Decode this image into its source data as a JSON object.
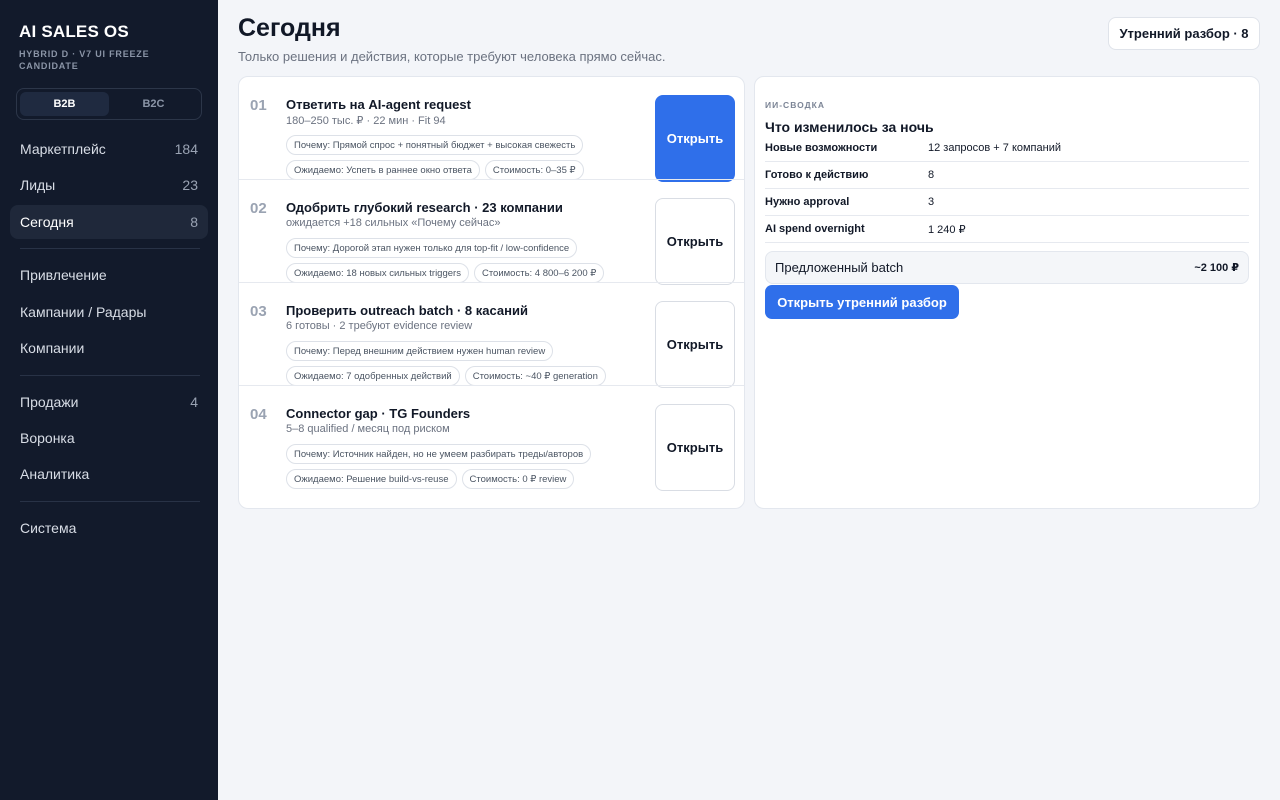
{
  "sidebar": {
    "brand": "AI SALES OS",
    "brand_sub": "HYBRID D · v7 UI FREEZE CANDIDATE",
    "segments": [
      {
        "label": "B2B",
        "active": true
      },
      {
        "label": "B2C",
        "active": false
      }
    ],
    "groups": [
      [
        {
          "label": "Маркетплейс",
          "count": "184"
        },
        {
          "label": "Лиды",
          "count": "23"
        },
        {
          "label": "Сегодня",
          "count": "8"
        }
      ],
      [
        {
          "label": "Привлечение",
          "count": ""
        },
        {
          "label": "Кампании / Радары",
          "count": ""
        },
        {
          "label": "Компании",
          "count": ""
        }
      ],
      [
        {
          "label": "Продажи",
          "count": "4"
        },
        {
          "label": "Воронка",
          "count": ""
        },
        {
          "label": "Аналитика",
          "count": ""
        }
      ],
      [
        {
          "label": "Система",
          "count": ""
        }
      ]
    ]
  },
  "header": {
    "title": "Сегодня",
    "subtitle": "Только решения и действия, которые требуют человека прямо сейчас.",
    "morning_button": "Утренний разбор · 8"
  },
  "tasks": [
    {
      "num": "01",
      "title": "Ответить на AI-agent request",
      "meta": "180–250 тыс. ₽ · 22 мин · Fit 94",
      "chips_row1": [
        "Почему: Прямой спрос + понятный бюджет + высокая свежесть"
      ],
      "chips_row2": [
        "Ожидаемо: Успеть в раннее окно ответа",
        "Стоимость: 0–35 ₽"
      ],
      "button": "Открыть",
      "primary": true
    },
    {
      "num": "02",
      "title": "Одобрить глубокий research · 23 компании",
      "meta": "ожидается +18 сильных «Почему сейчас»",
      "chips_row1": [
        "Почему: Дорогой этап нужен только для top-fit / low-confidence"
      ],
      "chips_row2": [
        "Ожидаемо: 18 новых сильных triggers",
        "Стоимость: 4 800–6 200 ₽"
      ],
      "button": "Открыть",
      "primary": false
    },
    {
      "num": "03",
      "title": "Проверить outreach batch · 8 касаний",
      "meta": "6 готовы · 2 требуют evidence review",
      "chips_row1": [
        "Почему: Перед внешним действием нужен human review"
      ],
      "chips_row2": [
        "Ожидаемо: 7 одобренных действий",
        "Стоимость: ~40 ₽ generation"
      ],
      "button": "Открыть",
      "primary": false
    },
    {
      "num": "04",
      "title": "Connector gap · TG Founders",
      "meta": "5–8 qualified / месяц под риском",
      "chips_row1": [
        "Почему: Источник найден, но не умеем разбирать треды/авторов"
      ],
      "chips_row2": [
        "Ожидаемо: Решение build-vs-reuse",
        "Стоимость: 0 ₽ review"
      ],
      "button": "Открыть",
      "primary": false
    }
  ],
  "summary": {
    "label": "ИИ-СВОДКА",
    "title": "Что изменилось за ночь",
    "rows": [
      {
        "key": "Новые возможности",
        "value": "12 запросов + 7 компаний"
      },
      {
        "key": "Готово к действию",
        "value": "8"
      },
      {
        "key": "Нужно approval",
        "value": "3"
      },
      {
        "key": "AI spend overnight",
        "value": "1 240 ₽"
      }
    ],
    "batch_label": "Предложенный batch",
    "batch_value": "~2 100 ₽",
    "open_button": "Открыть утренний разбор"
  },
  "colors": {
    "sidebar_bg": "#121a2b",
    "accent": "#2f6fea",
    "page_bg": "#f3f5f9"
  }
}
